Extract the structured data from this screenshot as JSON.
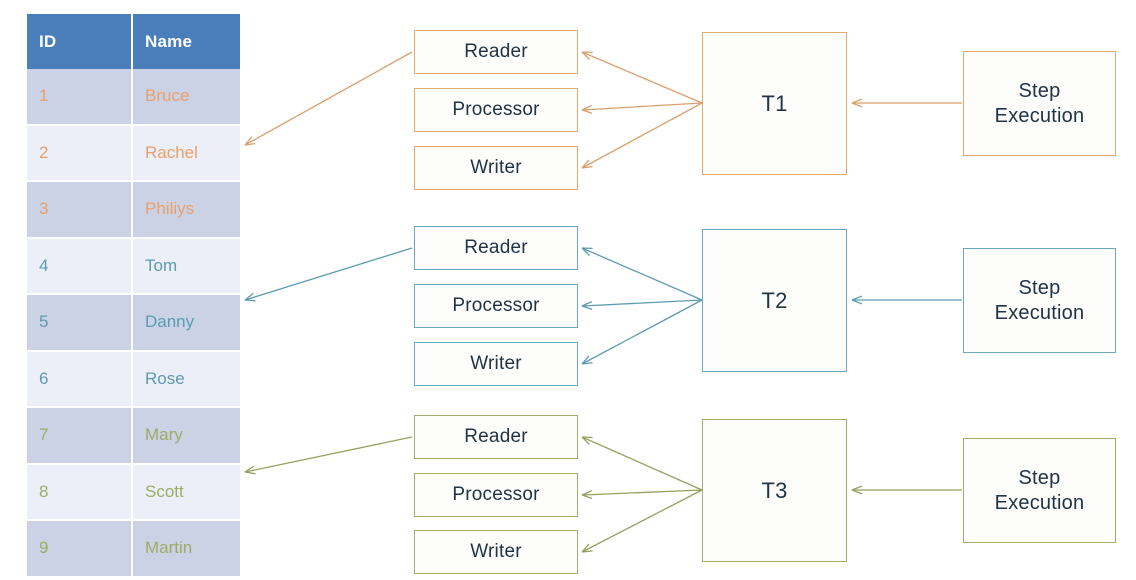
{
  "table": {
    "columns": [
      "ID",
      "Name"
    ],
    "rows": [
      {
        "id": "1",
        "name": "Bruce",
        "tone": "orange"
      },
      {
        "id": "2",
        "name": "Rachel",
        "tone": "orange"
      },
      {
        "id": "3",
        "name": "Philiys",
        "tone": "orange"
      },
      {
        "id": "4",
        "name": "Tom",
        "tone": "blue"
      },
      {
        "id": "5",
        "name": "Danny",
        "tone": "blue"
      },
      {
        "id": "6",
        "name": "Rose",
        "tone": "blue"
      },
      {
        "id": "7",
        "name": "Mary",
        "tone": "green"
      },
      {
        "id": "8",
        "name": "Scott",
        "tone": "green"
      },
      {
        "id": "9",
        "name": "Martin",
        "tone": "green"
      }
    ]
  },
  "groups": [
    {
      "key": "t1",
      "color": "#e0a96d",
      "thread": "T1",
      "stages": [
        "Reader",
        "Processor",
        "Writer"
      ],
      "step": "Step\nExecution",
      "step_line1": "Step",
      "step_line2": "Execution"
    },
    {
      "key": "t2",
      "color": "#6ba8bd",
      "thread": "T2",
      "stages": [
        "Reader",
        "Processor",
        "Writer"
      ],
      "step": "Step\nExecution",
      "step_line1": "Step",
      "step_line2": "Execution"
    },
    {
      "key": "t3",
      "color": "#a4ab6c",
      "thread": "T3",
      "stages": [
        "Reader",
        "Processor",
        "Writer"
      ],
      "step": "Step\nExecution",
      "step_line1": "Step",
      "step_line2": "Execution"
    }
  ],
  "palette": {
    "table_header_bg": "#4a7ebb",
    "table_row_odd": "#ccd2e5",
    "table_row_even": "#eceff7",
    "node_text": "#223344",
    "orange": "#e0a96d",
    "blue": "#6ba8bd",
    "green": "#a4ab6c"
  }
}
